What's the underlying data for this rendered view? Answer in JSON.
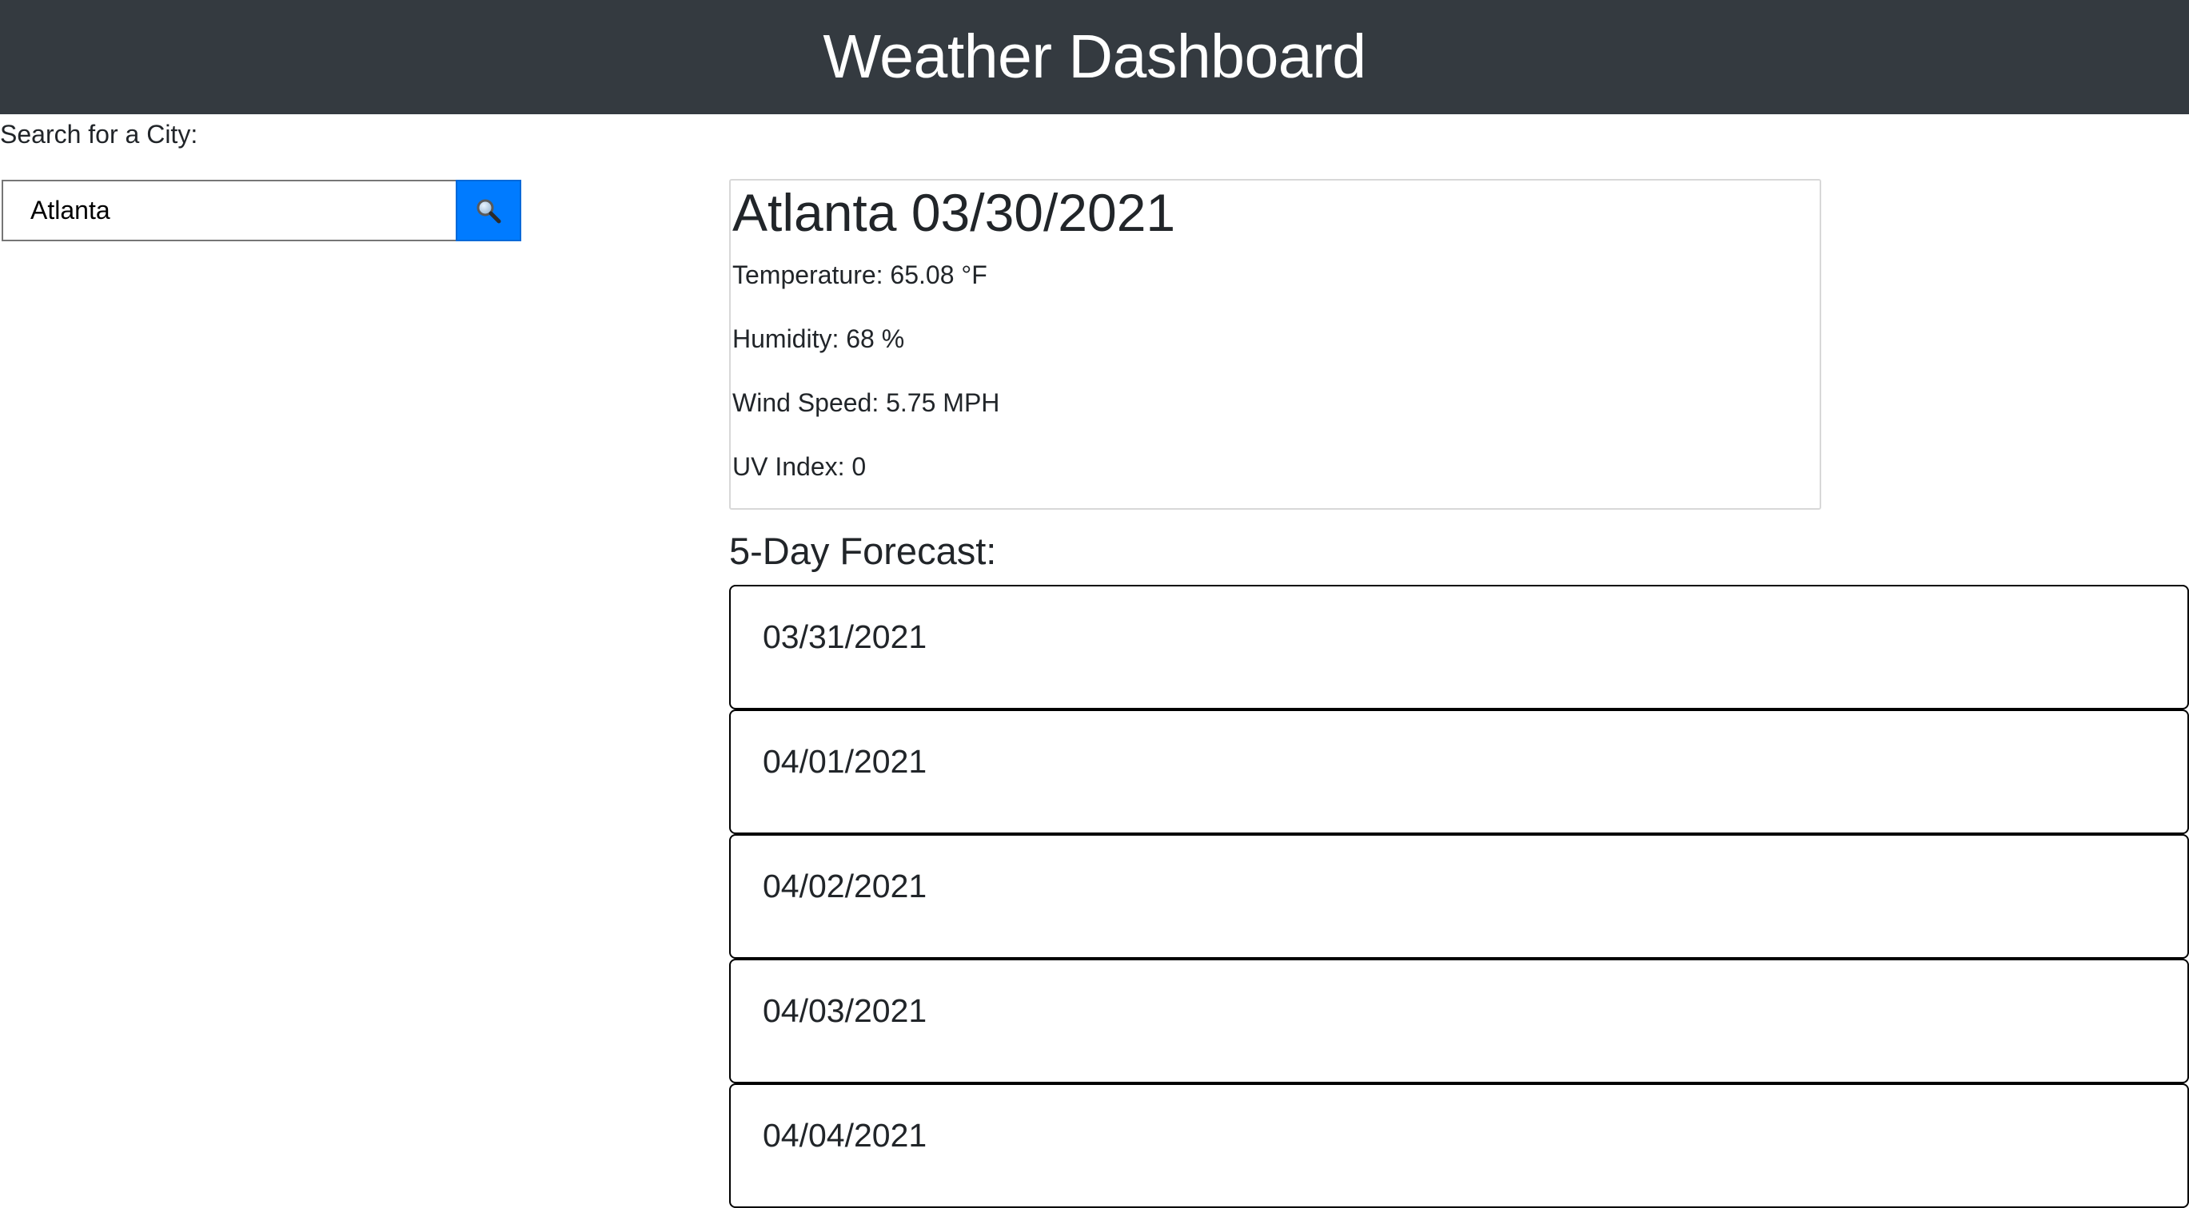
{
  "header": {
    "title": "Weather Dashboard"
  },
  "search": {
    "label": "Search for a City:",
    "value": "Atlanta",
    "button_icon": "search-icon",
    "button_color": "#007bff"
  },
  "current": {
    "title": "Atlanta 03/30/2021",
    "temperature": "Temperature: 65.08 °F",
    "humidity": "Humidity: 68 %",
    "wind_speed": "Wind Speed: 5.75 MPH",
    "uv_index": "UV Index: 0"
  },
  "forecast": {
    "title": "5-Day Forecast:",
    "days": [
      {
        "date": "03/31/2021"
      },
      {
        "date": "04/01/2021"
      },
      {
        "date": "04/02/2021"
      },
      {
        "date": "04/03/2021"
      },
      {
        "date": "04/04/2021"
      }
    ]
  },
  "colors": {
    "header_bg": "#343a40",
    "accent": "#007bff"
  }
}
